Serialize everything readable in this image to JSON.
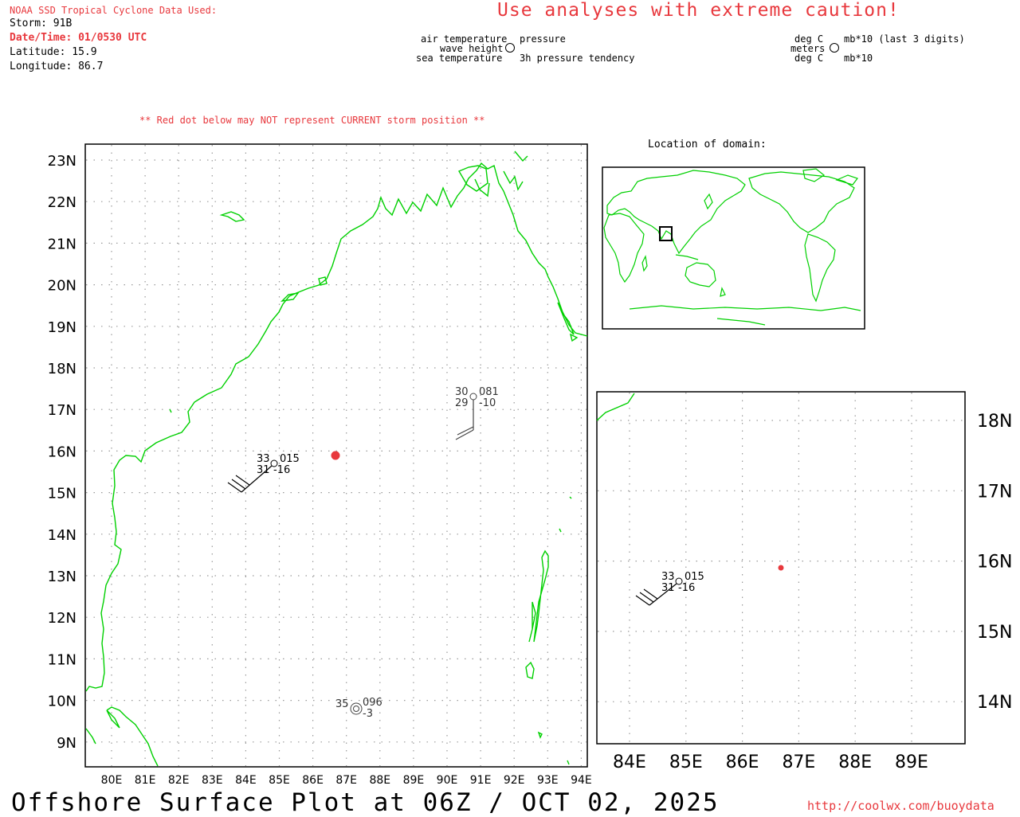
{
  "header": {
    "source_line": "NOAA SSD Tropical Cyclone Data Used:",
    "storm": "Storm: 91B",
    "datetime": "Date/Time: 01/0530 UTC",
    "latitude": "Latitude: 15.9",
    "longitude": "Longitude: 86.7",
    "caution": "Use analyses with extreme caution!",
    "red_dot_note": "** Red dot below may NOT represent CURRENT storm position **"
  },
  "legend": {
    "air_temp": "air temperature",
    "wave_height": "wave height",
    "sea_temp": "sea temperature",
    "pressure": "pressure",
    "pressure_tendency": "3h pressure tendency",
    "unit_deg_c_1": "deg C",
    "unit_meters": "meters",
    "unit_deg_c_2": "deg C",
    "unit_mb_last3": "mb*10 (last 3 digits)",
    "unit_mb": "mb*10"
  },
  "inset_world": {
    "title": "Location of domain:"
  },
  "main_map": {
    "lat_labels": [
      "23N",
      "22N",
      "21N",
      "20N",
      "19N",
      "18N",
      "17N",
      "16N",
      "15N",
      "14N",
      "13N",
      "12N",
      "11N",
      "10N",
      "9N"
    ],
    "lon_labels": [
      "80E",
      "81E",
      "82E",
      "83E",
      "84E",
      "85E",
      "86E",
      "87E",
      "88E",
      "89E",
      "90E",
      "91E",
      "92E",
      "93E",
      "94E"
    ],
    "stations": [
      {
        "air": "33",
        "pressure": "015",
        "sea": "31",
        "tendency": "-16"
      },
      {
        "air": "30",
        "pressure": "081",
        "sea": "29",
        "tendency": "-10"
      },
      {
        "air": "35",
        "pressure": "096",
        "sea": "",
        "tendency": "-3"
      }
    ]
  },
  "zoom_map": {
    "lat_labels": [
      "18N",
      "17N",
      "16N",
      "15N",
      "14N"
    ],
    "lon_labels": [
      "84E",
      "85E",
      "86E",
      "87E",
      "88E",
      "89E"
    ],
    "station": {
      "air": "33",
      "pressure": "015",
      "sea": "31",
      "tendency": "-16"
    }
  },
  "footer": {
    "title": "Offshore Surface Plot at 06Z / OCT 02, 2025",
    "url": "http://coolwx.com/buoydata"
  },
  "colors": {
    "coast": "#00d000",
    "storm": "#e8383d",
    "text_red": "#e8383d"
  }
}
